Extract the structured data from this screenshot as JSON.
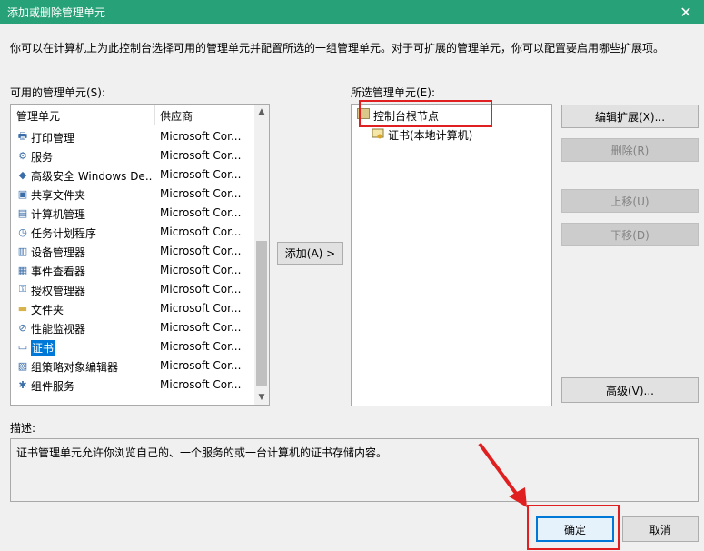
{
  "window": {
    "title": "添加或删除管理单元",
    "description": "你可以在计算机上为此控制台选择可用的管理单元并配置所选的一组管理单元。对于可扩展的管理单元，你可以配置要启用哪些扩展项。"
  },
  "available": {
    "label": "可用的管理单元(S):",
    "col_name": "管理单元",
    "col_vendor": "供应商",
    "items": [
      {
        "name": "打印管理",
        "vendor": "Microsoft Cor...",
        "icon": "printer-icon"
      },
      {
        "name": "服务",
        "vendor": "Microsoft Cor...",
        "icon": "gear-icon"
      },
      {
        "name": "高级安全 Windows De...",
        "vendor": "Microsoft Cor...",
        "icon": "firewall-icon"
      },
      {
        "name": "共享文件夹",
        "vendor": "Microsoft Cor...",
        "icon": "shared-folder-icon"
      },
      {
        "name": "计算机管理",
        "vendor": "Microsoft Cor...",
        "icon": "computer-management-icon"
      },
      {
        "name": "任务计划程序",
        "vendor": "Microsoft Cor...",
        "icon": "clock-icon"
      },
      {
        "name": "设备管理器",
        "vendor": "Microsoft Cor...",
        "icon": "device-manager-icon"
      },
      {
        "name": "事件查看器",
        "vendor": "Microsoft Cor...",
        "icon": "event-viewer-icon"
      },
      {
        "name": "授权管理器",
        "vendor": "Microsoft Cor...",
        "icon": "authorization-icon"
      },
      {
        "name": "文件夹",
        "vendor": "Microsoft Cor...",
        "icon": "folder-icon"
      },
      {
        "name": "性能监视器",
        "vendor": "Microsoft Cor...",
        "icon": "performance-icon"
      },
      {
        "name": "证书",
        "vendor": "Microsoft Cor...",
        "icon": "certificate-icon",
        "selected": true
      },
      {
        "name": "组策略对象编辑器",
        "vendor": "Microsoft Cor...",
        "icon": "group-policy-icon"
      },
      {
        "name": "组件服务",
        "vendor": "Microsoft Cor...",
        "icon": "component-services-icon"
      }
    ]
  },
  "add_button": "添加(A) >",
  "selected": {
    "label": "所选管理单元(E):",
    "root": "控制台根节点",
    "child": "证书(本地计算机)"
  },
  "buttons": {
    "edit_ext": "编辑扩展(X)...",
    "remove": "删除(R)",
    "move_up": "上移(U)",
    "move_down": "下移(D)",
    "advanced": "高级(V)...",
    "ok": "确定",
    "cancel": "取消"
  },
  "description": {
    "label": "描述:",
    "text": "证书管理单元允许你浏览自己的、一个服务的或一台计算机的证书存储内容。"
  },
  "colors": {
    "title_bar": "#27a177",
    "selection": "#0078d7",
    "highlight": "#e02020"
  }
}
